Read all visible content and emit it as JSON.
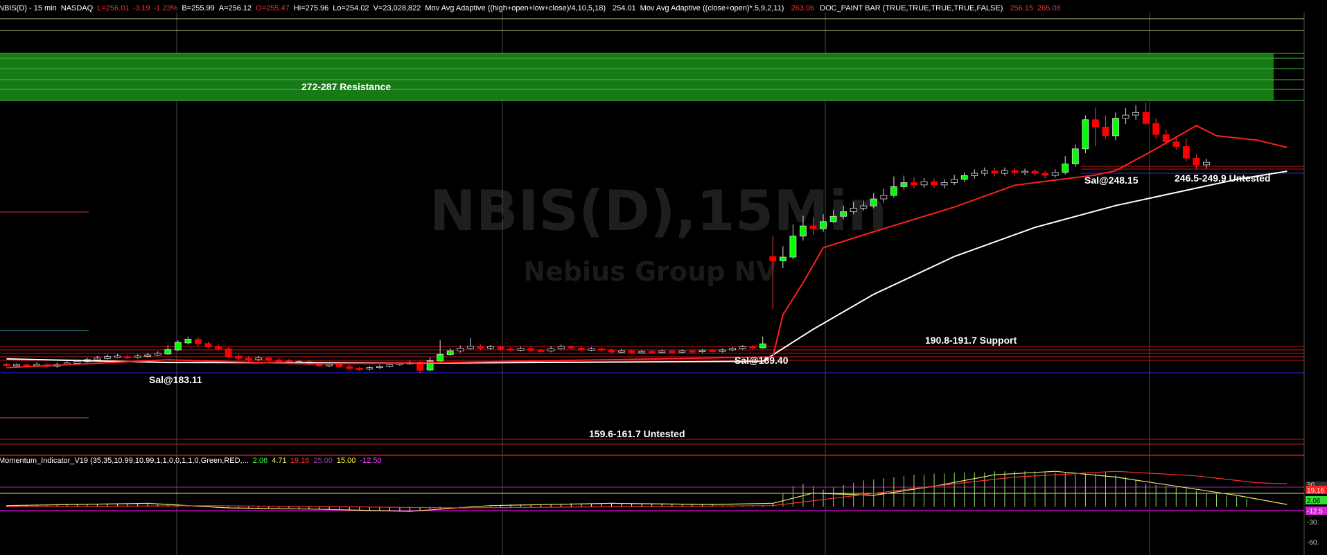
{
  "header": {
    "symbol": "NBIS(D) - 15 min",
    "exchange": "NASDAQ",
    "last": "L=256.01",
    "change": "-3.19",
    "change_pct": "-1.23%",
    "bid": "B=255.99",
    "ask": "A=256.12",
    "open": "O=255.47",
    "high": "Hi=275.96",
    "low": "Lo=254.02",
    "volume": "V=23,028,822",
    "ma1_label": "Mov Avg Adaptive ((high+open+low+close)/4,10,5,18)",
    "ma1_value": "254.01",
    "ma2_label": "Mov Avg Adaptive ((close+open)*.5,9,2,11)",
    "ma2_value": "263.06",
    "paint_label": "DOC_PAINT BAR (TRUE,TRUE,TRUE,TRUE,FALSE)",
    "paint_v1": "256.15",
    "paint_v2": "265.08"
  },
  "watermark": {
    "title": "NBIS(D),15Min",
    "subtitle": "Nebius Group NV"
  },
  "annotations": {
    "resistance": "272-287 Resistance",
    "sal1": "Sal@183.11",
    "sal2": "Sal@189.40",
    "sal3": "Sal@248.15",
    "untested_upper": "246.5-249.9 Untested",
    "support": "190.8-191.7 Support",
    "untested_lower": "159.6-161.7 Untested"
  },
  "momentum_header": {
    "label": "Momentum_Indicator_V19 (35,35,10.99,10.99,1,1,0,0,1,1,0,Green,RED,...",
    "v1": "2.06",
    "v2": "4.71",
    "v3": "19.16",
    "v4": "25.00",
    "v5": "15.00",
    "v6": "-12.50"
  },
  "momentum_axis": {
    "tick_30": "30.",
    "tick_19": "19.16",
    "tick_2": "2.06",
    "tick_m12": "-12.5",
    "tick_m30": "-30.",
    "tick_m60": "-60."
  },
  "colors": {
    "background": "#000000",
    "up_candle": "#00ff00",
    "down_candle": "#ff0000",
    "ma_red": "#ff2020",
    "ma_white": "#ffffff",
    "resistance_zone": "#1a7a1a",
    "support_line": "#c01818",
    "blue_line": "#2020c0",
    "osc_yellow": "#e8e870",
    "osc_green": "#90e070",
    "osc_red": "#ff3030",
    "osc_magenta": "#c000c0"
  },
  "chart_data": {
    "type": "line",
    "title": "NBIS(D),15Min",
    "subtitle": "Nebius Group NV",
    "ylim": [
      150,
      290
    ],
    "levels": [
      {
        "name": "272-287 Resistance",
        "low": 272,
        "high": 287
      },
      {
        "name": "246.5-249.9 Untested",
        "low": 246.5,
        "high": 249.9
      },
      {
        "name": "190.8-191.7 Support",
        "low": 190.8,
        "high": 191.7
      },
      {
        "name": "159.6-161.7 Untested",
        "low": 159.6,
        "high": 161.7
      }
    ],
    "markers": [
      {
        "label": "Sal@183.11",
        "value": 183.11
      },
      {
        "label": "Sal@189.40",
        "value": 189.4
      },
      {
        "label": "Sal@248.15",
        "value": 248.15
      }
    ],
    "candles": [
      [
        188,
        187.6,
        188.4,
        187.2
      ],
      [
        187.6,
        187.9,
        188.3,
        187.1
      ],
      [
        187.8,
        187.4,
        188.2,
        187.0
      ],
      [
        187.5,
        188.0,
        188.6,
        187.1
      ],
      [
        187.8,
        187.2,
        188.3,
        186.9
      ],
      [
        187.3,
        187.9,
        188.5,
        186.8
      ],
      [
        187.8,
        188.4,
        189.0,
        187.5
      ],
      [
        188.3,
        189.0,
        189.6,
        188.0
      ],
      [
        188.9,
        189.6,
        190.2,
        188.5
      ],
      [
        189.5,
        190.1,
        190.8,
        189.1
      ],
      [
        190.0,
        190.6,
        191.3,
        189.7
      ],
      [
        190.5,
        190.8,
        191.5,
        190.1
      ],
      [
        190.6,
        190.2,
        191.2,
        189.8
      ],
      [
        190.3,
        190.8,
        191.4,
        189.9
      ],
      [
        190.8,
        191.2,
        191.9,
        190.3
      ],
      [
        191.1,
        191.7,
        192.4,
        190.8
      ],
      [
        191.5,
        193.0,
        194.5,
        191.2
      ],
      [
        192.9,
        195.5,
        196.2,
        192.5
      ],
      [
        195.3,
        196.6,
        197.5,
        194.8
      ],
      [
        196.5,
        195.0,
        197.2,
        194.3
      ],
      [
        195.1,
        194.0,
        195.8,
        193.4
      ],
      [
        194.1,
        193.2,
        194.8,
        192.6
      ],
      [
        193.3,
        190.6,
        193.8,
        190.1
      ],
      [
        190.7,
        190.0,
        191.4,
        189.4
      ],
      [
        190.1,
        189.5,
        190.7,
        188.9
      ],
      [
        189.6,
        190.2,
        190.8,
        189.0
      ],
      [
        190.1,
        189.4,
        190.6,
        188.9
      ],
      [
        189.5,
        189.0,
        190.1,
        188.5
      ],
      [
        189.1,
        188.3,
        189.7,
        187.9
      ],
      [
        188.4,
        188.9,
        189.5,
        187.9
      ],
      [
        188.9,
        188.1,
        189.3,
        187.6
      ],
      [
        188.2,
        187.4,
        188.8,
        187.0
      ],
      [
        187.5,
        187.9,
        188.4,
        187.0
      ],
      [
        187.9,
        187.1,
        188.3,
        186.6
      ],
      [
        187.2,
        186.5,
        187.7,
        186.1
      ],
      [
        186.6,
        186.2,
        187.1,
        185.7
      ],
      [
        186.3,
        186.8,
        187.3,
        185.9
      ],
      [
        186.8,
        187.3,
        187.8,
        186.4
      ],
      [
        187.3,
        187.8,
        188.3,
        186.9
      ],
      [
        187.8,
        188.3,
        188.8,
        187.4
      ],
      [
        188.3,
        188.6,
        189.2,
        187.9
      ],
      [
        188.7,
        185.9,
        189.1,
        185.0
      ],
      [
        186.0,
        189.2,
        190.4,
        185.6
      ],
      [
        189.1,
        191.4,
        196.2,
        188.9
      ],
      [
        191.3,
        192.6,
        193.5,
        190.9
      ],
      [
        192.5,
        193.5,
        194.4,
        192.0
      ],
      [
        193.4,
        194.2,
        197.0,
        193.0
      ],
      [
        194.1,
        193.4,
        194.7,
        192.8
      ],
      [
        193.5,
        194.0,
        194.6,
        193.0
      ],
      [
        193.9,
        193.2,
        194.3,
        192.6
      ],
      [
        193.3,
        192.8,
        193.8,
        192.2
      ],
      [
        192.8,
        193.4,
        194.0,
        192.4
      ],
      [
        193.4,
        192.7,
        193.8,
        192.1
      ],
      [
        192.8,
        192.5,
        193.2,
        192.0
      ],
      [
        192.5,
        193.3,
        194.2,
        192.1
      ],
      [
        193.3,
        194.1,
        194.7,
        193.0
      ],
      [
        194.0,
        193.5,
        194.4,
        193.1
      ],
      [
        193.5,
        192.9,
        193.9,
        192.4
      ],
      [
        192.9,
        193.3,
        193.8,
        192.5
      ],
      [
        193.3,
        192.8,
        193.7,
        192.3
      ],
      [
        192.8,
        192.2,
        193.2,
        191.8
      ],
      [
        192.2,
        192.6,
        193.1,
        191.8
      ],
      [
        192.6,
        192.0,
        193.0,
        191.6
      ],
      [
        192.0,
        192.4,
        192.9,
        191.6
      ],
      [
        192.4,
        192.1,
        192.8,
        191.7
      ],
      [
        192.1,
        192.5,
        193.0,
        191.7
      ],
      [
        192.5,
        192.2,
        192.9,
        191.8
      ],
      [
        192.2,
        192.6,
        193.1,
        191.8
      ],
      [
        192.6,
        192.3,
        193.0,
        191.9
      ],
      [
        192.3,
        192.8,
        193.3,
        191.9
      ],
      [
        192.8,
        192.4,
        193.2,
        192.0
      ],
      [
        192.4,
        192.9,
        193.4,
        192.0
      ],
      [
        192.9,
        193.4,
        193.9,
        192.5
      ],
      [
        193.4,
        194.0,
        194.5,
        193.0
      ],
      [
        194.0,
        193.6,
        194.6,
        193.1
      ],
      [
        193.6,
        195.0,
        197.5,
        193.3
      ],
      [
        225.0,
        223.5,
        232.0,
        207.0
      ],
      [
        223.5,
        224.8,
        228.5,
        221.0
      ],
      [
        224.8,
        232.0,
        236.0,
        224.0
      ],
      [
        232.0,
        235.5,
        239.0,
        230.5
      ],
      [
        235.5,
        234.6,
        238.5,
        232.5
      ],
      [
        234.6,
        237.0,
        239.5,
        233.5
      ],
      [
        237.0,
        238.8,
        241.0,
        236.5
      ],
      [
        238.8,
        240.4,
        242.5,
        237.8
      ],
      [
        240.4,
        241.6,
        243.8,
        239.5
      ],
      [
        241.6,
        242.4,
        244.2,
        240.8
      ],
      [
        242.4,
        244.8,
        246.8,
        241.6
      ],
      [
        244.8,
        246.0,
        248.2,
        243.6
      ],
      [
        246.0,
        249.0,
        252.5,
        245.2
      ],
      [
        249.0,
        250.4,
        252.8,
        248.0
      ],
      [
        250.4,
        249.6,
        252.2,
        248.5
      ],
      [
        249.6,
        250.7,
        252.0,
        248.6
      ],
      [
        250.7,
        249.6,
        251.8,
        248.6
      ],
      [
        249.6,
        250.4,
        251.6,
        248.4
      ],
      [
        250.4,
        251.5,
        253.0,
        249.6
      ],
      [
        251.5,
        252.8,
        254.0,
        250.6
      ],
      [
        252.8,
        253.6,
        255.0,
        251.8
      ],
      [
        253.6,
        254.4,
        255.6,
        252.6
      ],
      [
        254.4,
        253.6,
        255.4,
        252.5
      ],
      [
        253.6,
        254.5,
        255.6,
        252.8
      ],
      [
        254.5,
        253.8,
        255.4,
        252.8
      ],
      [
        253.8,
        254.3,
        255.2,
        252.9
      ],
      [
        254.3,
        253.6,
        255.0,
        252.7
      ],
      [
        253.6,
        252.9,
        254.5,
        251.8
      ],
      [
        252.9,
        253.9,
        255.0,
        252.2
      ],
      [
        253.9,
        256.8,
        259.5,
        253.2
      ],
      [
        256.8,
        262.0,
        263.5,
        255.8
      ],
      [
        262.0,
        272.0,
        273.5,
        260.5
      ],
      [
        272.0,
        269.5,
        276.2,
        263.0
      ],
      [
        269.5,
        266.5,
        273.5,
        265.5
      ],
      [
        266.5,
        272.5,
        274.5,
        265.0
      ],
      [
        272.5,
        273.6,
        276.0,
        270.5
      ],
      [
        273.6,
        274.5,
        277.0,
        272.0
      ],
      [
        274.5,
        270.7,
        278.0,
        270.2
      ],
      [
        270.7,
        266.9,
        272.5,
        265.5
      ],
      [
        266.9,
        264.4,
        268.5,
        263.5
      ],
      [
        264.4,
        262.8,
        266.5,
        261.8
      ],
      [
        262.8,
        258.8,
        265.5,
        257.8
      ],
      [
        258.8,
        256.5,
        260.0,
        255.0
      ],
      [
        256.5,
        257.4,
        258.6,
        255.2
      ]
    ],
    "ma_white": [
      {
        "i": 0,
        "v": 189.8
      },
      {
        "i": 16,
        "v": 188.6
      },
      {
        "i": 42,
        "v": 188.4
      },
      {
        "i": 75,
        "v": 189.0
      },
      {
        "i": 80,
        "v": 200.0
      },
      {
        "i": 86,
        "v": 212.0
      },
      {
        "i": 94,
        "v": 225.0
      },
      {
        "i": 102,
        "v": 235.0
      },
      {
        "i": 110,
        "v": 242.5
      },
      {
        "i": 118,
        "v": 248.5
      },
      {
        "i": 122,
        "v": 251.5
      },
      {
        "i": 127,
        "v": 254.3
      }
    ],
    "ma_red": [
      {
        "i": 0,
        "v": 186.8
      },
      {
        "i": 16,
        "v": 189.5
      },
      {
        "i": 30,
        "v": 188.1
      },
      {
        "i": 42,
        "v": 188.5
      },
      {
        "i": 76,
        "v": 190.5
      },
      {
        "i": 77,
        "v": 205.0
      },
      {
        "i": 79,
        "v": 216.0
      },
      {
        "i": 81,
        "v": 228.0
      },
      {
        "i": 86,
        "v": 233.5
      },
      {
        "i": 94,
        "v": 242.0
      },
      {
        "i": 100,
        "v": 249.5
      },
      {
        "i": 108,
        "v": 253.0
      },
      {
        "i": 110,
        "v": 254.5
      },
      {
        "i": 114,
        "v": 262.0
      },
      {
        "i": 118,
        "v": 270.0
      },
      {
        "i": 120,
        "v": 266.5
      },
      {
        "i": 124,
        "v": 265.0
      },
      {
        "i": 127,
        "v": 262.5
      }
    ],
    "momentum": {
      "hlines": [
        30,
        19.16,
        2.06,
        -12.5
      ],
      "ylim": [
        -65,
        45
      ],
      "histogram": [
        1,
        1,
        1,
        1,
        1,
        2,
        2,
        2,
        2,
        2,
        3,
        3,
        3,
        3,
        3,
        2,
        2,
        2,
        1,
        1,
        1,
        0,
        -1,
        -1,
        -1,
        -1,
        -1,
        -1,
        -1,
        -2,
        -2,
        -2,
        -2,
        -2,
        -3,
        -3,
        -3,
        -3,
        -4,
        -4,
        -4,
        -3,
        -2,
        -2,
        -1,
        -1,
        0,
        0,
        1,
        1,
        2,
        2,
        2,
        2,
        2,
        2,
        3,
        3,
        3,
        3,
        3,
        3,
        3,
        3,
        3,
        3,
        2,
        2,
        2,
        2,
        2,
        1,
        1,
        1,
        1,
        1,
        3,
        12,
        18,
        20,
        18,
        15,
        17,
        19,
        21,
        23,
        24,
        25,
        26,
        27,
        28,
        28,
        29,
        29,
        30,
        30,
        30,
        30,
        31,
        31,
        31,
        31,
        31,
        30,
        30,
        30,
        30,
        29,
        29,
        30,
        28,
        26,
        23,
        20,
        19,
        18,
        17,
        16,
        14,
        12,
        11,
        10,
        9,
        7
      ],
      "yellow": [
        {
          "i": 0,
          "v": 1
        },
        {
          "i": 14,
          "v": 3
        },
        {
          "i": 22,
          "v": -1
        },
        {
          "i": 30,
          "v": -2
        },
        {
          "i": 40,
          "v": -4
        },
        {
          "i": 48,
          "v": 1
        },
        {
          "i": 60,
          "v": 3
        },
        {
          "i": 70,
          "v": 2
        },
        {
          "i": 76,
          "v": 3
        },
        {
          "i": 80,
          "v": 12
        },
        {
          "i": 86,
          "v": 10
        },
        {
          "i": 92,
          "v": 18
        },
        {
          "i": 98,
          "v": 28
        },
        {
          "i": 104,
          "v": 31
        },
        {
          "i": 110,
          "v": 26
        },
        {
          "i": 116,
          "v": 18
        },
        {
          "i": 122,
          "v": 10
        },
        {
          "i": 127,
          "v": 2
        }
      ],
      "red": [
        {
          "i": 0,
          "v": 0
        },
        {
          "i": 20,
          "v": 1
        },
        {
          "i": 45,
          "v": -1
        },
        {
          "i": 76,
          "v": 1
        },
        {
          "i": 90,
          "v": 16
        },
        {
          "i": 100,
          "v": 26
        },
        {
          "i": 110,
          "v": 31
        },
        {
          "i": 118,
          "v": 27
        },
        {
          "i": 124,
          "v": 21
        },
        {
          "i": 127,
          "v": 20
        }
      ]
    }
  }
}
